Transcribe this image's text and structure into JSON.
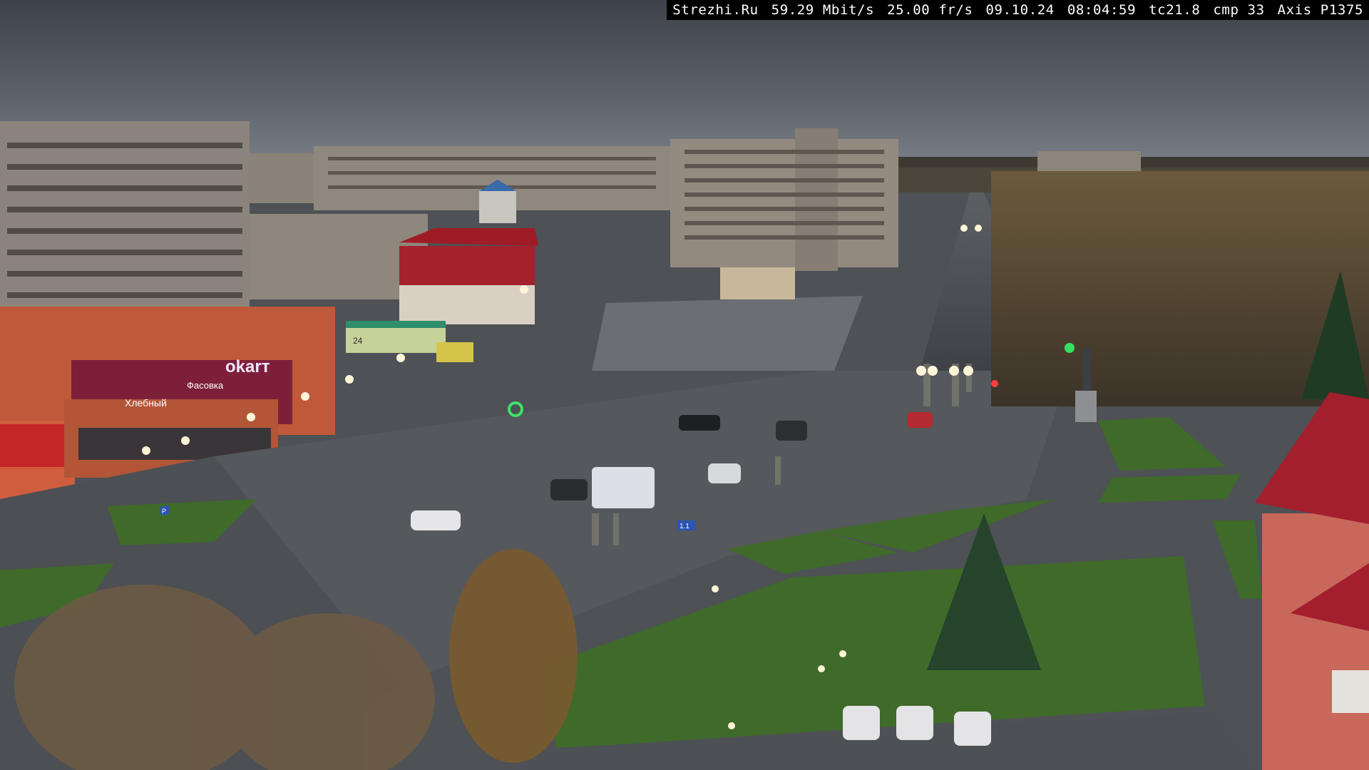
{
  "overlay": {
    "site": "Strezhi.Ru",
    "bitrate": "59.29 Mbit/s",
    "framerate": "25.00 fr/s",
    "date": "09.10.24",
    "time": "08:04:59",
    "tc": "tc21.8",
    "cmp": "cmp 33",
    "camera": "Axis P1375"
  },
  "signs": {
    "store_left": "Хлебный",
    "store_main": "okarт",
    "store_sub": "Фасовка",
    "banner_small": "24",
    "road_sign_left": "P",
    "road_sign_right": "1.1"
  },
  "colors": {
    "sky": "#5a6068",
    "grass": "#3f6a2a",
    "asphalt": "#4a4d52",
    "brick": "#c45a3c",
    "roof_red": "#a11c2a",
    "panel_building": "#8b847c"
  }
}
